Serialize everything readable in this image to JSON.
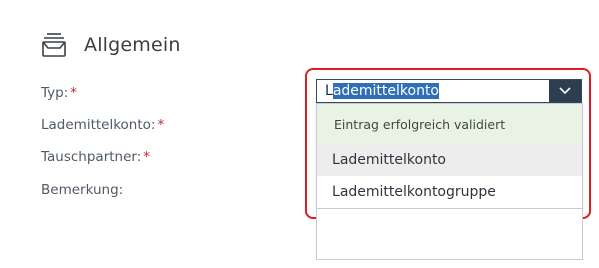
{
  "section": {
    "title": "Allgemein",
    "icon": "archive-box-icon"
  },
  "form": {
    "labels": [
      {
        "text": "Typ:",
        "required_marker": "*"
      },
      {
        "text": "Lademittelkonto:",
        "required_marker": "*"
      },
      {
        "text": "Tauschpartner:",
        "required_marker": "*"
      },
      {
        "text": "Bemerkung:",
        "required_marker": ""
      }
    ],
    "typ_select": {
      "value_prefix": "L",
      "value_selected": "ademittelkonto",
      "status_message": "Eintrag erfolgreich validiert",
      "options": [
        {
          "lead": "L",
          "rest": "ademittelkonto"
        },
        {
          "lead": "L",
          "rest": "ademittelkontogruppe"
        }
      ]
    }
  },
  "colors": {
    "highlight_border": "#e01b24",
    "required": "#c0282d",
    "selection": "#2f6fb8",
    "success_bg": "#e8f3e6",
    "arrow_bg": "#2c3e50"
  }
}
